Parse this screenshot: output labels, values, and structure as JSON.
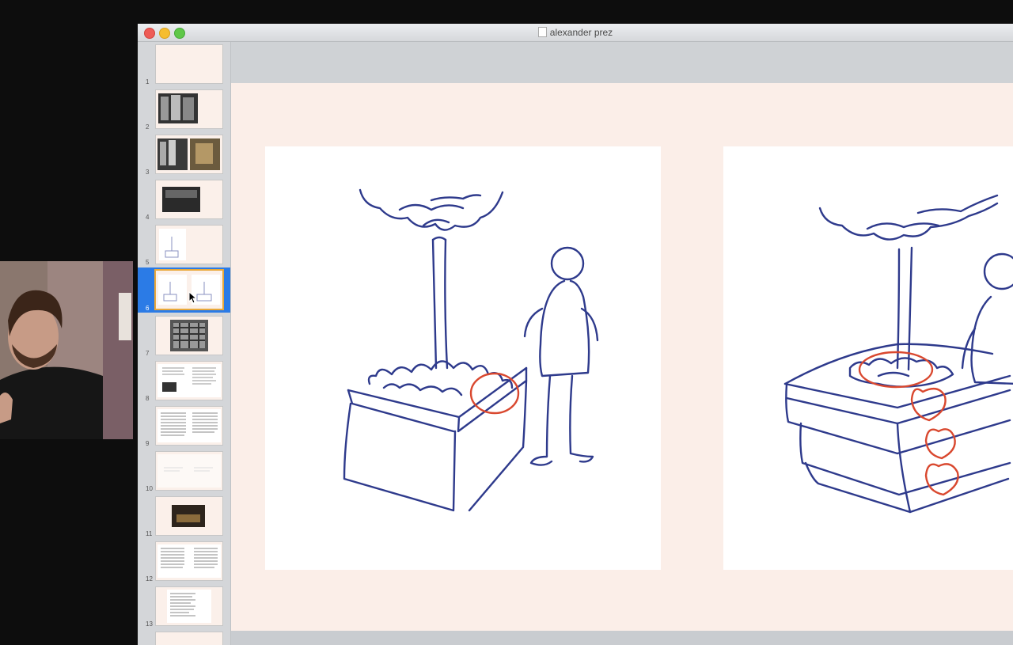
{
  "window": {
    "title": "alexander prez"
  },
  "slides": {
    "selected": 6,
    "items": [
      {
        "number": "1",
        "kind": "blank"
      },
      {
        "number": "2",
        "kind": "photo-buildings"
      },
      {
        "number": "3",
        "kind": "photo-pair"
      },
      {
        "number": "4",
        "kind": "photo-dark"
      },
      {
        "number": "5",
        "kind": "sketch"
      },
      {
        "number": "6",
        "kind": "sketch-pair"
      },
      {
        "number": "7",
        "kind": "pattern"
      },
      {
        "number": "8",
        "kind": "text-figure"
      },
      {
        "number": "9",
        "kind": "text-columns"
      },
      {
        "number": "10",
        "kind": "faint"
      },
      {
        "number": "11",
        "kind": "photo-small"
      },
      {
        "number": "12",
        "kind": "text-columns"
      },
      {
        "number": "13",
        "kind": "text-list"
      }
    ]
  },
  "colors": {
    "sketch_ink": "#2e3a8c",
    "annotation": "#d9482f",
    "selection": "#2b7be6",
    "slide_background": "#fbeee8"
  }
}
